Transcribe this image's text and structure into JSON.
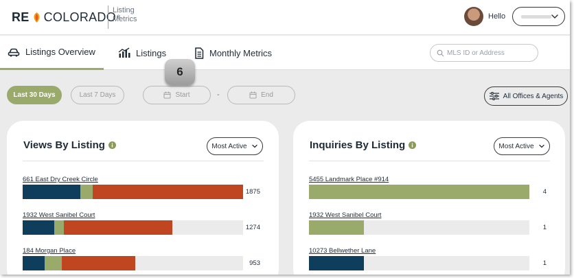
{
  "colors": {
    "accent": "#9aaa6b",
    "navy": "#0f3e5c",
    "olive": "#9aaa6b",
    "rust": "#bf4620",
    "track": "#ebebeb"
  },
  "header": {
    "brand_left": "RE",
    "brand_right": "COLORADO",
    "brand_mark": "®",
    "app_title": "Listing Metrics",
    "greeting": "Hello",
    "user_chevron_icon": "chevron-down-icon"
  },
  "tabs": [
    {
      "label": "Listings Overview",
      "icon": "car-icon",
      "active": true
    },
    {
      "label": "Listings",
      "icon": "bar-chart-icon",
      "active": false
    },
    {
      "label": "Monthly Metrics",
      "icon": "document-icon",
      "active": false
    }
  ],
  "search": {
    "placeholder": "MLS ID or Address"
  },
  "step_badge": "6",
  "filters": {
    "last30": "Last 30 Days",
    "last7": "Last 7 Days",
    "start": "Start",
    "separator": "-",
    "end": "End",
    "offices": "All Offices & Agents"
  },
  "views_card": {
    "title": "Views By Listing",
    "sort_label": "Most Active",
    "rows": [
      {
        "address": "661 East Dry Creek Circle",
        "value": "1875",
        "segments": [
          {
            "color": "navy",
            "pct": 0.262
          },
          {
            "color": "olive",
            "pct": 0.057
          },
          {
            "color": "rust",
            "pct": 0.681
          }
        ]
      },
      {
        "address": "1932 West Sanibel Court",
        "value": "1274",
        "segments": [
          {
            "color": "navy",
            "pct": 0.142
          },
          {
            "color": "olive",
            "pct": 0.045
          },
          {
            "color": "rust",
            "pct": 0.493
          }
        ]
      },
      {
        "address": "184 Morgan Place",
        "value": "953",
        "segments": [
          {
            "color": "navy",
            "pct": 0.099
          },
          {
            "color": "olive",
            "pct": 0.077
          },
          {
            "color": "rust",
            "pct": 0.332
          }
        ]
      }
    ]
  },
  "inquiries_card": {
    "title": "Inquiries By Listing",
    "sort_label": "Most Active",
    "rows": [
      {
        "address": "5455 Landmark Place #914",
        "value": "4",
        "segments": [
          {
            "color": "olive",
            "pct": 1.0
          }
        ]
      },
      {
        "address": "1932 West Sanibel Court",
        "value": "1",
        "segments": [
          {
            "color": "olive",
            "pct": 0.25
          }
        ]
      },
      {
        "address": "10273 Bellwether Lane",
        "value": "1",
        "segments": [
          {
            "color": "navy",
            "pct": 0.25
          }
        ]
      }
    ]
  }
}
